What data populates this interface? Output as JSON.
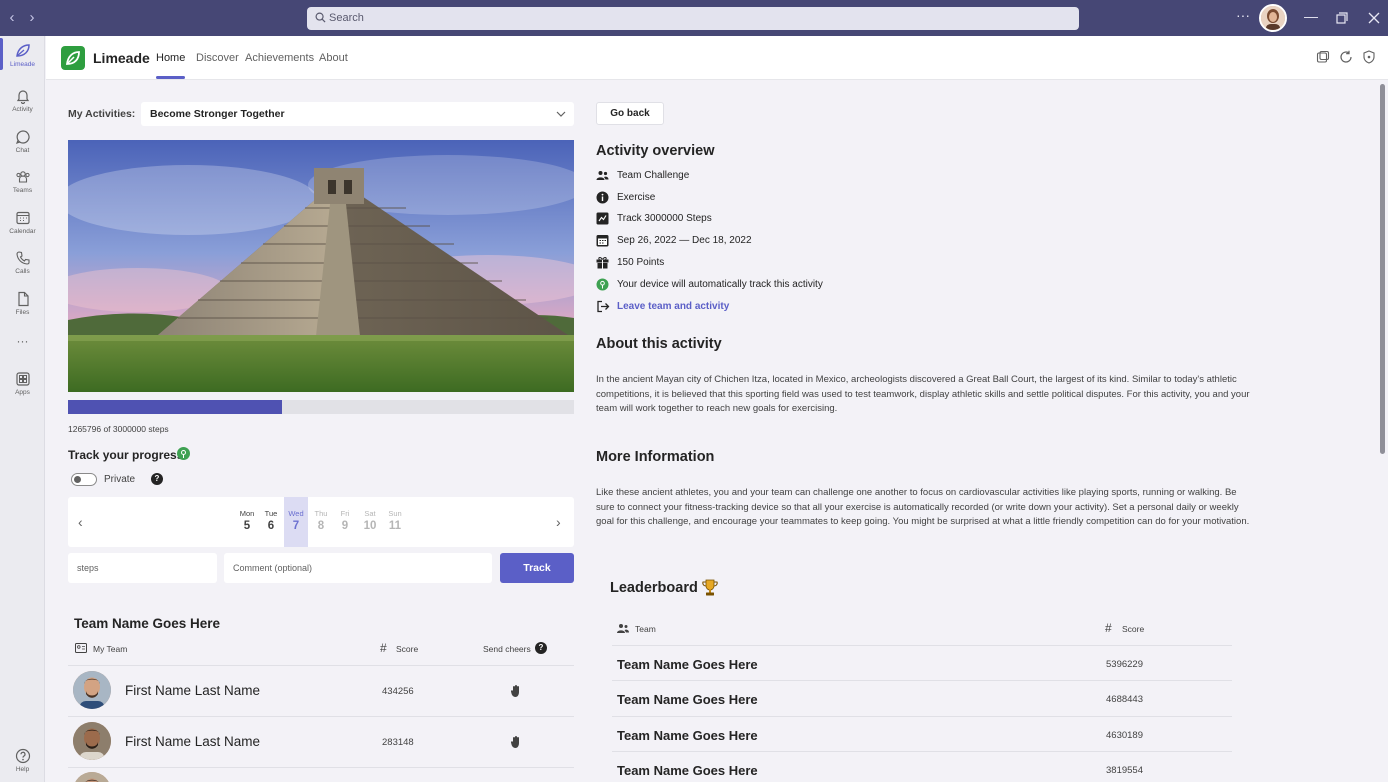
{
  "window": {
    "search_placeholder": "Search",
    "more_label": "···"
  },
  "rail": {
    "items": [
      {
        "label": "Limeade",
        "icon": "limeade-icon",
        "active": true
      },
      {
        "label": "Activity",
        "icon": "bell-icon"
      },
      {
        "label": "Chat",
        "icon": "chat-icon"
      },
      {
        "label": "Teams",
        "icon": "teams-icon"
      },
      {
        "label": "Calendar",
        "icon": "calendar-icon"
      },
      {
        "label": "Calls",
        "icon": "phone-icon"
      },
      {
        "label": "Files",
        "icon": "file-icon"
      },
      {
        "label": "Apps",
        "icon": "apps-icon"
      },
      {
        "label": "Help",
        "icon": "help-icon"
      }
    ],
    "more": "···"
  },
  "app": {
    "name": "Limeade",
    "tabs": [
      "Home",
      "Discover",
      "Achievements",
      "About"
    ],
    "active_tab": "Home"
  },
  "activities": {
    "label": "My Activities:",
    "selected": "Become Stronger Together"
  },
  "progress": {
    "current": 1265796,
    "goal": 3000000,
    "fraction": 0.422,
    "caption": "1265796 of 3000000 steps"
  },
  "tracker": {
    "title": "Track your progress",
    "private_label": "Private",
    "help": "?",
    "days": [
      {
        "name": "Mon",
        "date": "5",
        "state": "past"
      },
      {
        "name": "Tue",
        "date": "6",
        "state": "past"
      },
      {
        "name": "Wed",
        "date": "7",
        "state": "selected"
      },
      {
        "name": "Thu",
        "date": "8",
        "state": "future"
      },
      {
        "name": "Fri",
        "date": "9",
        "state": "future"
      },
      {
        "name": "Sat",
        "date": "10",
        "state": "future"
      },
      {
        "name": "Sun",
        "date": "11",
        "state": "future"
      }
    ],
    "prev": "‹",
    "next": "›",
    "steps_placeholder": "steps",
    "comment_placeholder": "Comment (optional)",
    "track_label": "Track"
  },
  "team": {
    "title": "Team Name Goes Here",
    "col_team": "My Team",
    "col_score": "Score",
    "col_cheers": "Send cheers",
    "members": [
      {
        "name": "First Name Last Name",
        "score": "434256"
      },
      {
        "name": "First Name Last Name",
        "score": "283148"
      }
    ]
  },
  "overview": {
    "back_label": "Go back",
    "title": "Activity overview",
    "rows": [
      {
        "icon": "people-icon",
        "text": "Team Challenge"
      },
      {
        "icon": "info-icon",
        "text": "Exercise"
      },
      {
        "icon": "tracker-icon",
        "text": "Track 3000000 Steps"
      },
      {
        "icon": "calendar-icon",
        "text": "Sep 26, 2022 — Dec 18, 2022"
      },
      {
        "icon": "gift-icon",
        "text": "150 Points"
      },
      {
        "icon": "device-icon",
        "text": "Your device will automatically track this activity"
      },
      {
        "icon": "leave-icon",
        "text": "Leave team and activity",
        "link": true
      }
    ]
  },
  "about": {
    "title": "About this activity",
    "body": "In the ancient Mayan city of Chichen Itza, located in Mexico, archeologists discovered a Great Ball Court, the largest of its kind. Similar to today's athletic competitions, it is believed that this sporting field was used to test teamwork, display athletic skills and settle political disputes. For this activity, you and your team will work together to reach new goals for exercising."
  },
  "more_info": {
    "title": "More Information",
    "body": "Like these ancient athletes, you and your team can challenge one another to focus on cardiovascular activities like playing sports, running or walking. Be sure to connect your fitness-tracking device so that all your exercise is automatically recorded (or write down your activity). Set a personal daily or weekly goal for this challenge, and encourage your teammates to keep going. You might be surprised at what a little friendly competition can do for your motivation."
  },
  "leaderboard": {
    "title": "Leaderboard",
    "col_team": "Team",
    "col_score": "Score",
    "rows": [
      {
        "name": "Team Name Goes Here",
        "score": "5396229"
      },
      {
        "name": "Team Name Goes Here",
        "score": "4688443"
      },
      {
        "name": "Team Name Goes Here",
        "score": "4630189"
      },
      {
        "name": "Team Name Goes Here",
        "score": "3819554"
      }
    ]
  },
  "colors": {
    "accent": "#5b5fc7",
    "titlebar": "#464775",
    "brand_green": "#2e9e3f"
  }
}
